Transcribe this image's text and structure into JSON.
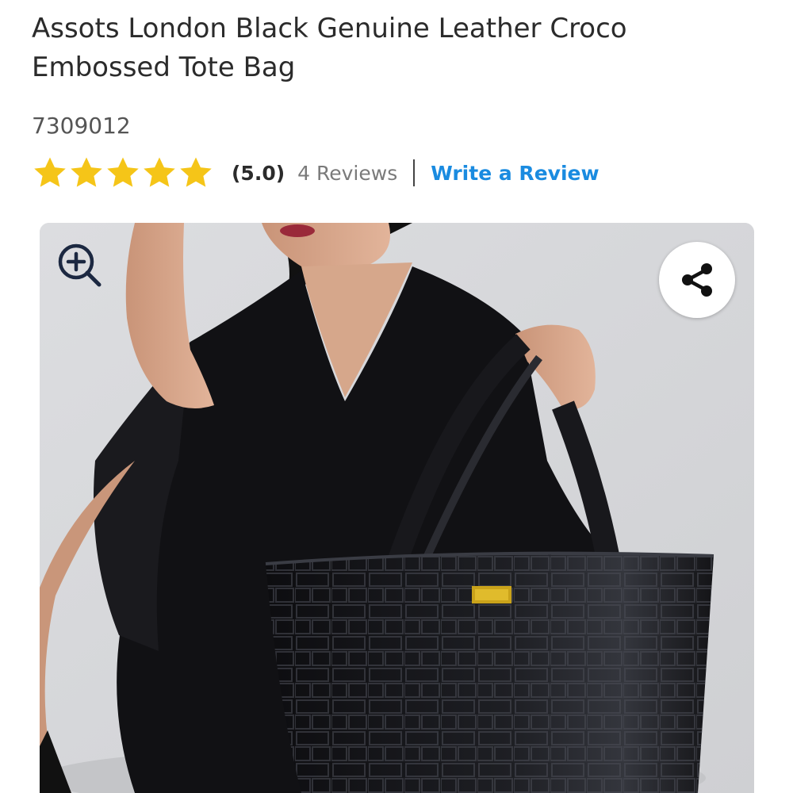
{
  "product": {
    "title": "Assots London Black Genuine Leather Croco Embossed Tote Bag",
    "sku": "7309012"
  },
  "rating": {
    "stars": 5,
    "max_stars": 5,
    "score_label": "(5.0)",
    "reviews_label": "4 Reviews",
    "write_review_label": "Write a Review",
    "star_color": "#f5c518",
    "link_color": "#1a8be0"
  },
  "image": {
    "subject": "model in black dress holding black croco-embossed leather tote bag",
    "zoom_icon": "zoom-in-icon",
    "share_icon": "share-icon"
  }
}
